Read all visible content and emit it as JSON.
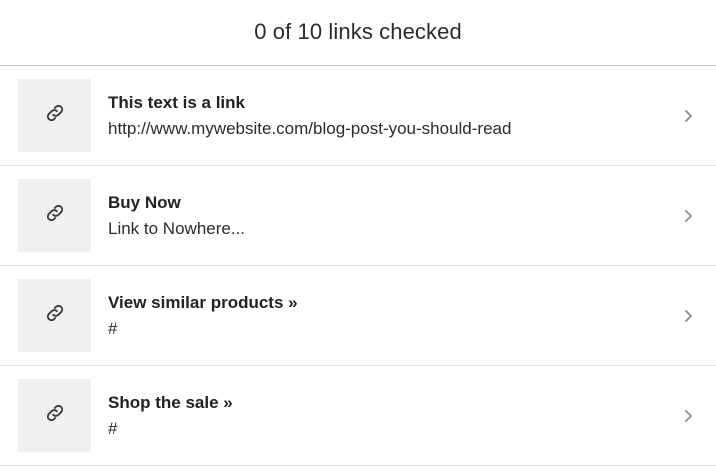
{
  "header": {
    "title": "0 of 10 links checked"
  },
  "colors": {
    "thumb_bg": "#f0f0f0",
    "text": "#222222",
    "divider": "#e0e0e0",
    "chevron": "#8a8a8a"
  },
  "icons": {
    "thumb": "link-icon",
    "row_action": "chevron-right-icon"
  },
  "links": [
    {
      "title": "This text is a link",
      "url": "http://www.mywebsite.com/blog-post-you-should-read"
    },
    {
      "title": "Buy Now",
      "url": "Link to Nowhere..."
    },
    {
      "title": "View similar products »",
      "url": "#"
    },
    {
      "title": "Shop the sale »",
      "url": "#"
    }
  ]
}
